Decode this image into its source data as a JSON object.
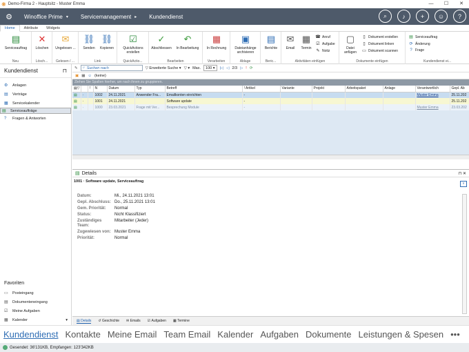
{
  "window": {
    "title": "Demo-Firma 2 - Hauptsitz - Muster Emma",
    "controls": [
      "—",
      "☐",
      "✕"
    ]
  },
  "header": {
    "items": [
      "Winoffice Prime",
      "Servicemanagement",
      "Kundendienst"
    ],
    "separators": [
      "▾",
      "▸",
      ""
    ]
  },
  "ribbon_tabs": [
    "Home",
    "Attribute",
    "Widgets"
  ],
  "ribbon": {
    "groups": [
      "Neu",
      "Lösch...",
      "Gelesen / ...",
      "Link",
      "QuickActio...",
      "Bearbeiten",
      "Verarbeiten",
      "Ablage",
      "Beric...",
      "Aktivitäten einfügen",
      "Dokumente einfügen",
      "Kundendienst ei..."
    ],
    "buttons": [
      "Serviceauftrag",
      "Löschen",
      "Ungelesen ...",
      "Senden",
      "Kopieren",
      "QuickActions erstellen",
      "Abschliessen",
      "In Bearbeitung",
      "In Rechnung",
      "Dateianhänge archivieren",
      "Berichte",
      "Email",
      "Termin",
      "Datei anfügen"
    ],
    "small": [
      "Anruf",
      "Aufgabe",
      "Notiz",
      "Dokument erstellen",
      "Dokument linken",
      "Dokument scannen",
      "Serviceauftrag",
      "Änderung",
      "Frage"
    ]
  },
  "leftnav": {
    "title": "Kundendienst",
    "items": [
      "Anlagen",
      "Verträge",
      "Servicekalender",
      "Serviceaufträge",
      "Fragen & Antworten"
    ],
    "selected": 3,
    "favorites_title": "Favoriten",
    "favorites": [
      "Posteingang",
      "Dokumenteneingang",
      "Meine Aufgaben",
      "Kalender"
    ]
  },
  "toolbar": {
    "search_placeholder": "Suchen nach",
    "advanced": "Erweiterte Suche",
    "max_label": "Max.",
    "max_value": "100",
    "page": "2/3",
    "filter_value": "(keine)"
  },
  "grid": {
    "group_hint": "Ziehen Sie Spalten hierher, um nach ihnen zu gruppieren.",
    "columns": [
      "",
      "!",
      "N",
      "Datum",
      "Typ",
      "Betreff",
      "! Artikel",
      "Variante",
      "Projekt",
      "Arbeitspaket",
      "Anlage",
      "Verantwortlich",
      "Gepl. Ab"
    ],
    "rows": [
      [
        "·",
        "",
        "1002",
        "24.11.2021",
        "Anwender Fra...",
        "Emailkonten einrichten",
        "-",
        "",
        "",
        "",
        "",
        "Muster Emma",
        "25.11.202"
      ],
      [
        "·",
        "",
        "1001",
        "24.11.2021",
        "",
        "Software update",
        "-",
        "",
        "",
        "",
        "",
        "",
        "25.11.202"
      ],
      [
        "·",
        "",
        "1000",
        "23.03.2021",
        "Frage mit Ver...",
        "Besprechung Module",
        "-",
        "",
        "",
        "",
        "",
        "Muster Emma",
        "23.03.202"
      ]
    ]
  },
  "details": {
    "title": "Details",
    "subtitle": "1001 · Software update, Serviceauftrag",
    "fields": [
      {
        "k": "Datum:",
        "v": "Mi., 24.11.2021 13:01"
      },
      {
        "k": "Gepl. Abschluss:",
        "v": "Do., 25.11.2021 13:01"
      },
      {
        "k": "Gem. Priorität:",
        "v": "Normal"
      },
      {
        "k": "Status:",
        "v": "Nicht Klassifiziert"
      },
      {
        "k": "Zuständiges Team:",
        "v": "Mitarbeiter (Jeder)"
      },
      {
        "k": "Zugewiesen von:",
        "v": "Muster Emma"
      },
      {
        "k": "Priorität:",
        "v": "Normal"
      }
    ],
    "tabs": [
      "Details",
      "Geschichte",
      "Emails",
      "Aufgaben",
      "Termine"
    ]
  },
  "bottomnav": [
    "Kundendienst",
    "Kontakte",
    "Meine Email",
    "Team Email",
    "Kalender",
    "Aufgaben",
    "Dokumente",
    "Leistungen & Spesen",
    "•••"
  ],
  "status": "Gesendet: 36'131KB, Empfangen: 123'342KB",
  "colors": {
    "header": "#4e5a6a",
    "accent": "#2e6db4"
  }
}
